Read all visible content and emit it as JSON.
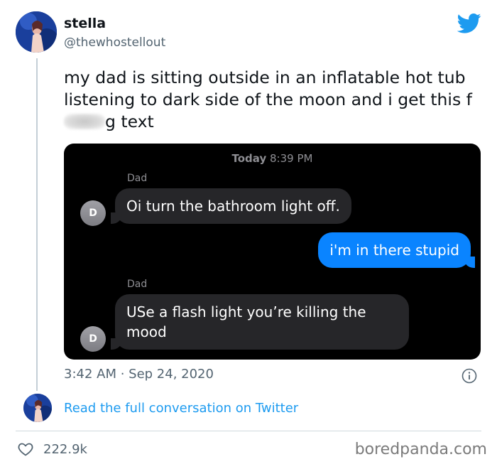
{
  "author": {
    "display_name": "stella",
    "handle": "@thewhostellout"
  },
  "tweet": {
    "text_before": "my dad is sitting outside in an inflatable hot tub listening to dark side of the moon and i get this f",
    "text_after": "g text",
    "timestamp": "3:42 AM · Sep 24, 2020"
  },
  "imessage": {
    "timestamp_bold": "Today",
    "timestamp_time": " 8:39 PM",
    "messages": [
      {
        "sender": "Dad",
        "direction": "incoming",
        "text": "Oi turn the bathroom light off.",
        "avatar_initial": "D"
      },
      {
        "direction": "outgoing",
        "text": "i'm in there stupid"
      },
      {
        "sender": "Dad",
        "direction": "incoming",
        "text": "USe a flash light you’re killing the mood",
        "avatar_initial": "D"
      }
    ]
  },
  "read_more_link": "Read the full conversation on Twitter",
  "engagement": {
    "likes": "222.9k"
  },
  "watermark": "boredpanda.com",
  "colors": {
    "twitter_blue": "#1d9bf0",
    "imessage_blue": "#0a84ff",
    "imessage_gray": "#262629"
  },
  "icons": [
    "twitter-bird-icon",
    "info-icon",
    "heart-icon"
  ]
}
